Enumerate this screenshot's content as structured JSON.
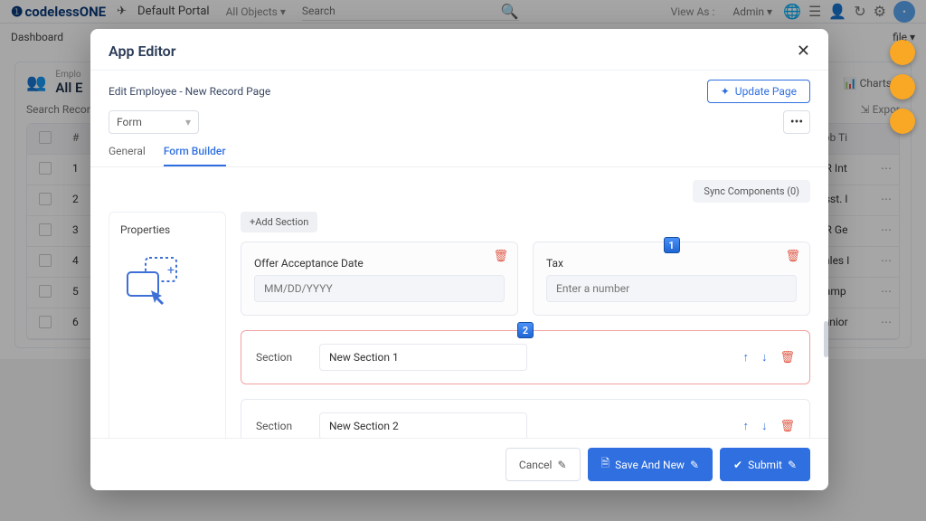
{
  "header": {
    "logo": "codelessONE",
    "portal_label": "Default Portal",
    "all_objects": "All Objects",
    "search_placeholder": "Search",
    "view_as": "View As :",
    "role": "Admin"
  },
  "nav": {
    "dashboard": "Dashboard",
    "profile": "file ▾"
  },
  "card": {
    "category": "Emplo",
    "title": "All E",
    "charts": "Charts ▾",
    "search_placeholder": "Search Recor",
    "export": "Expor"
  },
  "table": {
    "col_hash": "#",
    "col_job": "Job Ti",
    "rows": [
      {
        "n": "1",
        "job": "HR Int"
      },
      {
        "n": "2",
        "job": "Asst. I"
      },
      {
        "n": "3",
        "job": "HR Ge"
      },
      {
        "n": "4",
        "job": "Sales I"
      },
      {
        "n": "5",
        "job": "Camp"
      },
      {
        "n": "6",
        "job": "Junior"
      }
    ]
  },
  "modal": {
    "title": "App Editor",
    "breadcrumb": "Edit  Employee  -  New Record  Page",
    "update_btn": "Update Page",
    "view_select": "Form",
    "tab_general": "General",
    "tab_builder": "Form Builder",
    "sync_btn": "Sync Components (0)",
    "properties": "Properties",
    "add_section": "+Add Section",
    "field1_label": "Offer Acceptance Date",
    "field1_placeholder": "MM/DD/YYYY",
    "field2_label": "Tax",
    "field2_placeholder": "Enter a number",
    "marker1": "1",
    "marker2": "2",
    "section_label": "Section",
    "section1_value": "New Section 1",
    "section2_value": "New Section 2",
    "cancel": "Cancel",
    "save_new": "Save And New",
    "submit": "Submit"
  }
}
